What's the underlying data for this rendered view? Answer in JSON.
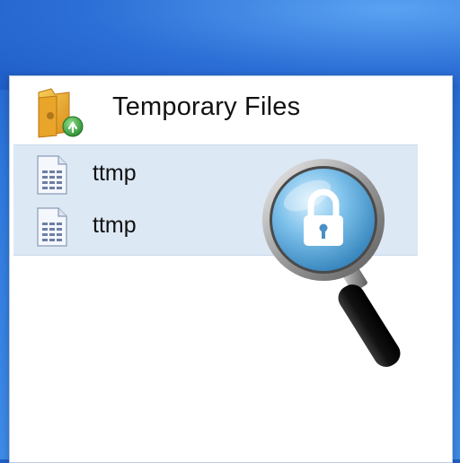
{
  "header": {
    "title": "Temporary Files",
    "icon": "folder-with-green-badge-icon"
  },
  "files": [
    {
      "name": "ttmp",
      "icon": "document-icon"
    },
    {
      "name": "ttmp",
      "icon": "document-icon"
    }
  ],
  "overlay": {
    "icon": "magnifier-lock-icon"
  },
  "colors": {
    "desktop_bg": "#2f79dd",
    "window_bg": "#ffffff",
    "selection_bg": "#dde8f5",
    "folder": "#e8a627",
    "badge": "#3aa63a",
    "lens": "#6fb4e0"
  }
}
